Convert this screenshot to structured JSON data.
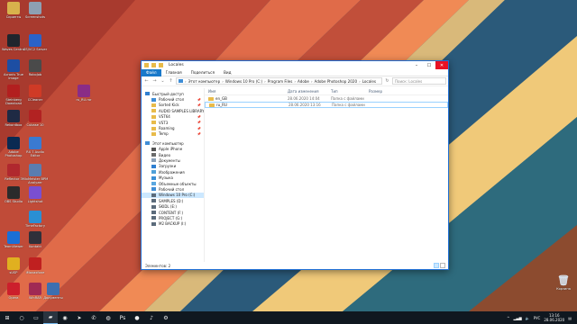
{
  "desktop": {
    "icons": [
      {
        "label": "Скрипты",
        "icon": "folder-icon",
        "color": "#d8b24c"
      },
      {
        "label": "Screenshots",
        "icon": "folder-icon",
        "color": "#8da0b3"
      },
      {
        "label": "Waves Central",
        "icon": "waves-icon",
        "color": "#20252d"
      },
      {
        "label": "CS/VC2 Server",
        "icon": "server-icon",
        "color": "#2b62c8"
      },
      {
        "label": "Acronis True Image",
        "icon": "acronis-icon",
        "color": "#1d4ea3"
      },
      {
        "label": "RoboJob",
        "icon": "robot-icon",
        "color": "#4a4a4a"
      },
      {
        "label": "Steinberg Download",
        "icon": "steinberg-icon",
        "color": "#b21f1f"
      },
      {
        "label": "CCleaner",
        "icon": "ccleaner-icon",
        "color": "#cf3a26"
      },
      {
        "label": "ru_RU.rar",
        "icon": "archive-icon",
        "color": "#8a2c86"
      },
      {
        "label": "Cubase 10",
        "icon": "cubase-icon",
        "color": "#b22222"
      },
      {
        "label": "Rekordbox",
        "icon": "rekordbox-icon",
        "color": "#1f2a44"
      },
      {
        "label": "RX 7 Audio Editor",
        "icon": "izotope-icon",
        "color": "#3a7ad1"
      },
      {
        "label": "Adobe Photoshop",
        "icon": "photoshop-icon",
        "color": "#0b2a52"
      },
      {
        "label": "MixMeister BPM Analyzer",
        "icon": "mixmeister-icon",
        "color": "#5a7db0"
      },
      {
        "label": "Reflector 3",
        "icon": "reflector-icon",
        "color": "#b0282e"
      },
      {
        "label": "Lightshot",
        "icon": "feather-icon",
        "color": "#7a4fd1"
      },
      {
        "label": "OBS Studio",
        "icon": "obs-icon",
        "color": "#2b2b2b"
      },
      {
        "label": "TimeFactory",
        "icon": "timefactory-icon",
        "color": "#2a8fd4"
      },
      {
        "label": "TeamViewer",
        "icon": "teamviewer-icon",
        "color": "#1a6fd6"
      },
      {
        "label": "Kontakt",
        "icon": "kontakt-icon",
        "color": "#30303a"
      },
      {
        "label": "sUSP",
        "icon": "warning-icon",
        "color": "#e0b020"
      },
      {
        "label": "iMovaxfone",
        "icon": "record-icon",
        "color": "#c02020"
      },
      {
        "label": "Opera",
        "icon": "opera-icon",
        "color": "#cc1f2c"
      },
      {
        "label": "WinRAR",
        "icon": "winrar-icon",
        "color": "#a02a54"
      },
      {
        "label": "Документы",
        "icon": "docs-icon",
        "color": "#3d6fb0"
      }
    ],
    "recycle_bin": {
      "label": "Корзина",
      "icon": "recycle-bin-icon"
    }
  },
  "window": {
    "title": "Locales",
    "ribbon_tabs": [
      "Файл",
      "Главная",
      "Поделиться",
      "Вид"
    ],
    "address": [
      "Этот компьютер",
      "Windows 10 Pro (C:)",
      "Program Files",
      "Adobe",
      "Adobe Photoshop 2020",
      "Locales"
    ],
    "search_placeholder": "Поиск: Locales",
    "nav": {
      "quick_access": {
        "label": "Быстрый доступ",
        "items": [
          {
            "label": "Рабочий стол",
            "icon": "desktop-icon",
            "color": "#3f8dd6",
            "pinned": true
          },
          {
            "label": "Sorted Kick",
            "icon": "folder-icon",
            "color": "#e8bb4a",
            "pinned": true
          },
          {
            "label": "AUDIO SAMPLES LIBRARY",
            "icon": "folder-icon",
            "color": "#e8bb4a",
            "pinned": true
          },
          {
            "label": "VST64",
            "icon": "folder-icon",
            "color": "#e8bb4a",
            "pinned": true
          },
          {
            "label": "VST3",
            "icon": "folder-icon",
            "color": "#e8bb4a",
            "pinned": true
          },
          {
            "label": "Roaming",
            "icon": "folder-icon",
            "color": "#e8bb4a",
            "pinned": true
          },
          {
            "label": "Temp",
            "icon": "folder-icon",
            "color": "#e8bb4a",
            "pinned": true
          }
        ]
      },
      "this_pc": {
        "label": "Этот компьютер",
        "items": [
          {
            "label": "Apple iPhone",
            "icon": "phone-icon",
            "color": "#555555"
          },
          {
            "label": "Видео",
            "icon": "video-icon",
            "color": "#6a6a6a"
          },
          {
            "label": "Документы",
            "icon": "documents-icon",
            "color": "#8aa0b8"
          },
          {
            "label": "Загрузки",
            "icon": "downloads-icon",
            "color": "#2f7fd1"
          },
          {
            "label": "Изображения",
            "icon": "pictures-icon",
            "color": "#4fa0d8"
          },
          {
            "label": "Музыка",
            "icon": "music-icon",
            "color": "#3a8fd6"
          },
          {
            "label": "Объемные объекты",
            "icon": "3d-objects-icon",
            "color": "#5aa7e0"
          },
          {
            "label": "Рабочий стол",
            "icon": "desktop-icon",
            "color": "#3f8dd6"
          },
          {
            "label": "Windows 10 Pro (C:)",
            "icon": "drive-icon",
            "color": "#5b6b7b",
            "selected": true
          },
          {
            "label": "SAMPLES (D:)",
            "icon": "drive-icon",
            "color": "#5b6b7b"
          },
          {
            "label": "SKIDL (E:)",
            "icon": "drive-icon",
            "color": "#5b6b7b"
          },
          {
            "label": "CONTENT (F:)",
            "icon": "drive-icon",
            "color": "#5b6b7b"
          },
          {
            "label": "PROJECT (G:)",
            "icon": "drive-icon",
            "color": "#5b6b7b"
          },
          {
            "label": "M2 BACKUP (I:)",
            "icon": "drive-icon",
            "color": "#5b6b7b"
          }
        ]
      }
    },
    "columns": [
      "Имя",
      "Дата изменения",
      "Тип",
      "Размер"
    ],
    "files": [
      {
        "name": "en_GB",
        "date": "28.06.2020 14:04",
        "type": "Папка с файлами",
        "size": ""
      },
      {
        "name": "ru_RU",
        "date": "28.06.2020 13:16",
        "type": "Папка с файлами",
        "size": "",
        "focused": true
      }
    ],
    "status": "Элементов: 2"
  },
  "taskbar": {
    "apps": [
      {
        "name": "start-icon",
        "glyph": "⊞"
      },
      {
        "name": "search-icon",
        "glyph": "○"
      },
      {
        "name": "task-view-icon",
        "glyph": "▭"
      },
      {
        "name": "explorer-icon",
        "glyph": "▰"
      },
      {
        "name": "chrome-icon",
        "glyph": "◉"
      },
      {
        "name": "telegram-icon",
        "glyph": "➤"
      },
      {
        "name": "whatsapp-icon",
        "glyph": "✆"
      },
      {
        "name": "spotify-icon",
        "glyph": "◍"
      },
      {
        "name": "ps-icon",
        "glyph": "Ps"
      },
      {
        "name": "obs-taskbar-icon",
        "glyph": "●"
      },
      {
        "name": "media-icon",
        "glyph": "♪"
      },
      {
        "name": "settings-icon",
        "glyph": "⚙"
      }
    ],
    "tray_lang": "РУС",
    "time": "13:16",
    "date": "28.06.2020"
  }
}
